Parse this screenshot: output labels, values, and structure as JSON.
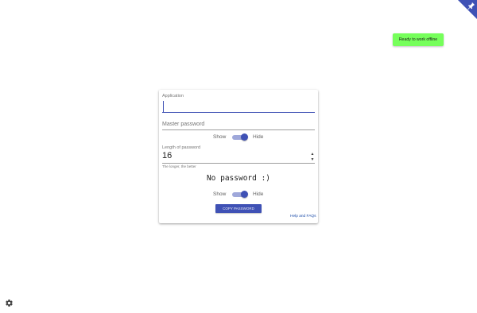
{
  "app": {
    "offline_badge": "Ready to work offline",
    "pin_icon": "pin-icon",
    "settings_icon": "gear-icon",
    "accent_color": "#3f51b5",
    "offline_color": "#76ff5b"
  },
  "form": {
    "application": {
      "label": "Application",
      "value": ""
    },
    "master_password": {
      "placeholder": "Master password",
      "value": ""
    },
    "master_toggle": {
      "show_label": "Show",
      "hide_label": "Hide",
      "state": "hide"
    },
    "length": {
      "label": "Length of password",
      "value": "16",
      "helper": "The longer, the better"
    },
    "result_text": "No password :)",
    "result_toggle": {
      "show_label": "Show",
      "hide_label": "Hide",
      "state": "hide"
    },
    "copy_button": "COPY PASSWORD",
    "help_link": "Help and FAQs"
  }
}
